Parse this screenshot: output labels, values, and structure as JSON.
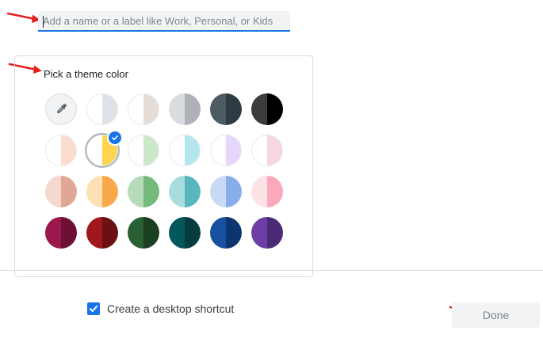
{
  "name_field": {
    "value": "",
    "placeholder": "Add a name or a label like Work, Personal, or Kids"
  },
  "theme": {
    "title": "Pick a theme color",
    "picker_icon": "eyedropper-icon",
    "selected_index": 7,
    "swatches": [
      {
        "id": "custom",
        "left": "#f1f3f4",
        "right": "#f1f3f4"
      },
      {
        "id": "grey-light",
        "left": "#ffffff",
        "right": "#dee1e6"
      },
      {
        "id": "beige",
        "left": "#ffffff",
        "right": "#e4dcd5"
      },
      {
        "id": "grey",
        "left": "#dadce0",
        "right": "#aeb1b8"
      },
      {
        "id": "slate",
        "left": "#4c5a62",
        "right": "#2f3b42"
      },
      {
        "id": "black",
        "left": "#3c3c3c",
        "right": "#000000"
      },
      {
        "id": "peach-light",
        "left": "#ffffff",
        "right": "#fcdccf"
      },
      {
        "id": "yellow",
        "left": "#ffffff",
        "right": "#ffd54f"
      },
      {
        "id": "green-light",
        "left": "#ffffff",
        "right": "#cbe8c8"
      },
      {
        "id": "cyan-light",
        "left": "#ffffff",
        "right": "#b4e6ef"
      },
      {
        "id": "lavender-light",
        "left": "#ffffff",
        "right": "#e6d6fb"
      },
      {
        "id": "pink-light",
        "left": "#ffffff",
        "right": "#f6d6e2"
      },
      {
        "id": "rose",
        "left": "#f5d8cf",
        "right": "#e0a797"
      },
      {
        "id": "orange",
        "left": "#fde0b3",
        "right": "#f9a94b"
      },
      {
        "id": "green",
        "left": "#b6dbb8",
        "right": "#76b97d"
      },
      {
        "id": "teal",
        "left": "#a9dcdc",
        "right": "#5ab6bd"
      },
      {
        "id": "blue",
        "left": "#c8d9f5",
        "right": "#88aeea"
      },
      {
        "id": "pink",
        "left": "#fde2e6",
        "right": "#f9a9b9"
      },
      {
        "id": "magenta-dark",
        "left": "#9c174b",
        "right": "#6e0f35"
      },
      {
        "id": "red-dark",
        "left": "#a0181d",
        "right": "#6b1114"
      },
      {
        "id": "green-dark",
        "left": "#285f33",
        "right": "#1a3f21"
      },
      {
        "id": "teal-dark",
        "left": "#04585a",
        "right": "#043c3f"
      },
      {
        "id": "blue-dark",
        "left": "#17509e",
        "right": "#0d3670"
      },
      {
        "id": "purple-dark",
        "left": "#6d3fa6",
        "right": "#4b2b78"
      }
    ]
  },
  "shortcut": {
    "checked": true,
    "label": "Create a desktop shortcut"
  },
  "done_button": {
    "label": "Done"
  },
  "colors": {
    "accent": "#1a73e8",
    "annotation_arrow": "#e3201b"
  }
}
